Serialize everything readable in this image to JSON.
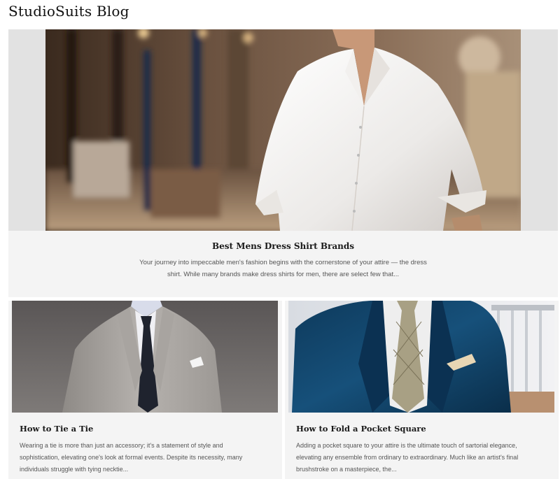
{
  "site": {
    "title": "StudioSuits Blog"
  },
  "featured_post": {
    "title": "Best Mens Dress Shirt Brands",
    "excerpt": "Your journey into impeccable men's fashion begins with the cornerstone of your attire — the dress shirt. While many brands make dress shirts for men, there are select few that...",
    "image": "man-white-dress-shirt-photo"
  },
  "posts": [
    {
      "title": "How to Tie a Tie",
      "excerpt": "Wearing a tie is more than just an accessory; it's a statement of style and sophistication, elevating one's look at formal events. Despite its necessity, many individuals struggle with tying necktie...",
      "image": "grey-suit-navy-tie-photo"
    },
    {
      "title": "How to Fold a Pocket Square",
      "excerpt": "Adding a pocket square to your attire is the ultimate touch of sartorial elegance, elevating any ensemble from ordinary to extraordinary. Much like an artist's final brushstroke on a masterpiece, the...",
      "image": "blue-velvet-jacket-pocket-square-photo"
    }
  ]
}
